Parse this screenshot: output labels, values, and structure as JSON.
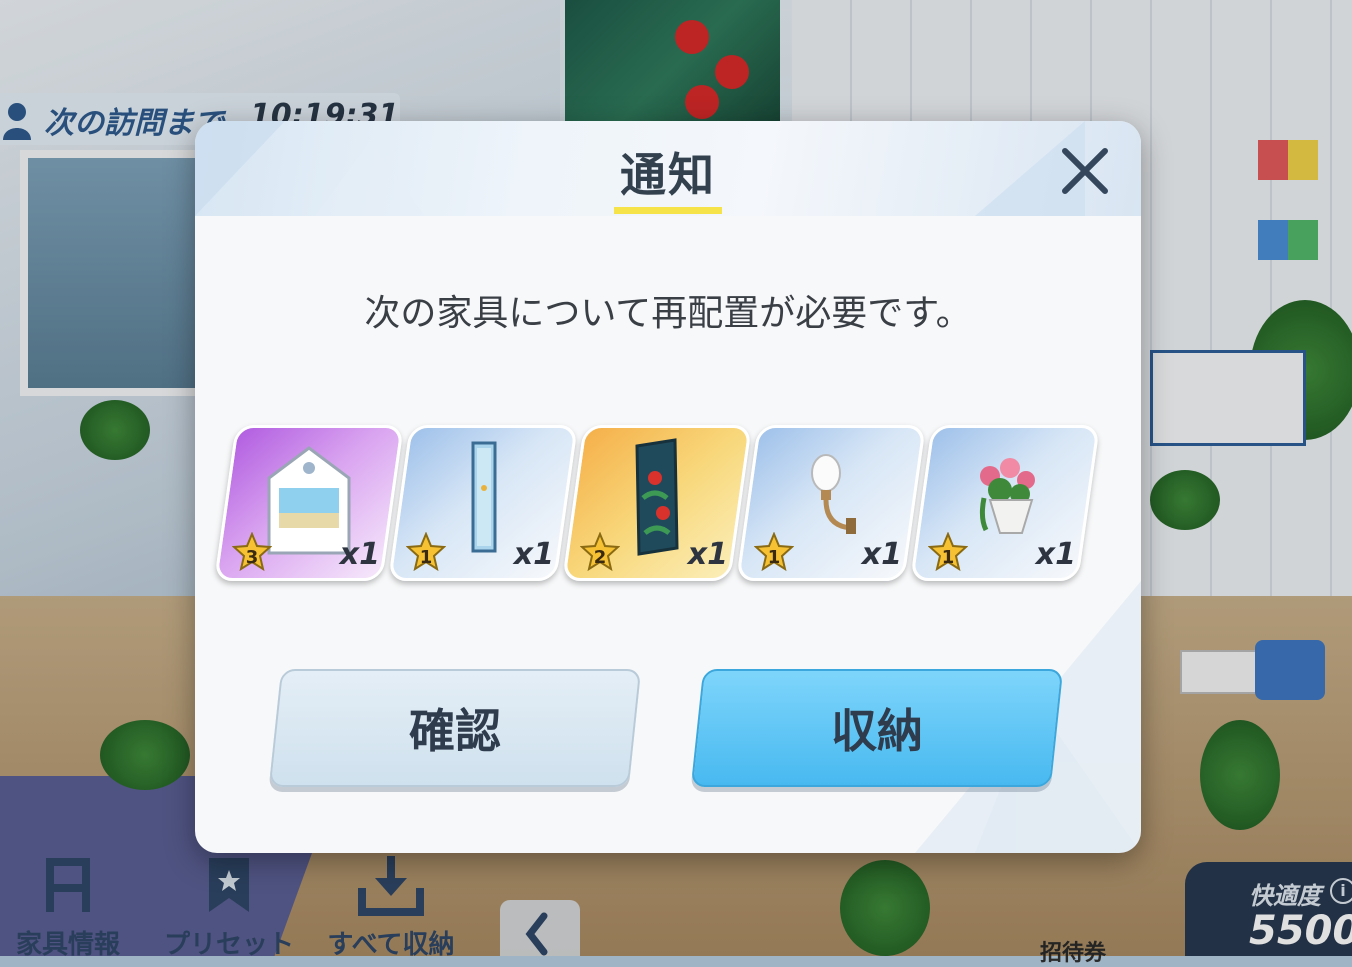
{
  "hud": {
    "visit_label": "次の訪問まで",
    "visit_time": "10:19:31",
    "toolbar": [
      {
        "label": "家具情報",
        "icon": "chair-icon"
      },
      {
        "label": "プリセット",
        "icon": "bookmark-icon"
      },
      {
        "label": "すべて収納",
        "icon": "download-tray-icon"
      }
    ],
    "comfort_label": "快適度",
    "comfort_value": "5500",
    "ticket_label": "招待券"
  },
  "dialog": {
    "title": "通知",
    "message": "次の家具について再配置が必要です。",
    "items": [
      {
        "name": "white-window-frame",
        "rarity": "3",
        "quantity": "x1",
        "icon": "window-icon"
      },
      {
        "name": "blue-panel",
        "rarity": "1",
        "quantity": "x1",
        "icon": "panel-icon"
      },
      {
        "name": "hibiscus-tapestry",
        "rarity": "2",
        "quantity": "x1",
        "icon": "tapestry-icon"
      },
      {
        "name": "wall-lamp",
        "rarity": "1",
        "quantity": "x1",
        "icon": "lamp-icon"
      },
      {
        "name": "flower-basket",
        "rarity": "1",
        "quantity": "x1",
        "icon": "flower-basket-icon"
      }
    ],
    "confirm_label": "確認",
    "store_label": "収納"
  },
  "colors": {
    "title_underline": "#f6e34a",
    "store_button": "#48b9f0",
    "confirm_button": "#d9e8f2",
    "comfort_panel": "#27384f",
    "rarity_star": "#f6c234"
  }
}
